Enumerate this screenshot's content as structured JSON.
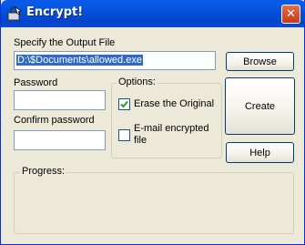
{
  "window": {
    "title": "Encrypt!",
    "close_glyph": "✕",
    "icon": "encrypt-app-icon"
  },
  "output": {
    "label": "Specify the Output File",
    "value": "D:\\$Documents\\allowed.exe",
    "browse_label": "Browse"
  },
  "password": {
    "label": "Password",
    "value": ""
  },
  "confirm": {
    "label": "Confirm password",
    "value": ""
  },
  "options": {
    "title": "Options:",
    "erase": {
      "label": "Erase the Original",
      "checked": true
    },
    "email": {
      "label_line1": "E-mail encrypted",
      "label_line2": "file",
      "checked": false
    }
  },
  "buttons": {
    "create": "Create",
    "help": "Help"
  },
  "progress": {
    "title": "Progress:"
  },
  "colors": {
    "titlebar": "#0556e0",
    "dialog_bg": "#ece9d8",
    "selection": "#316ac5",
    "close": "#c6391a"
  }
}
